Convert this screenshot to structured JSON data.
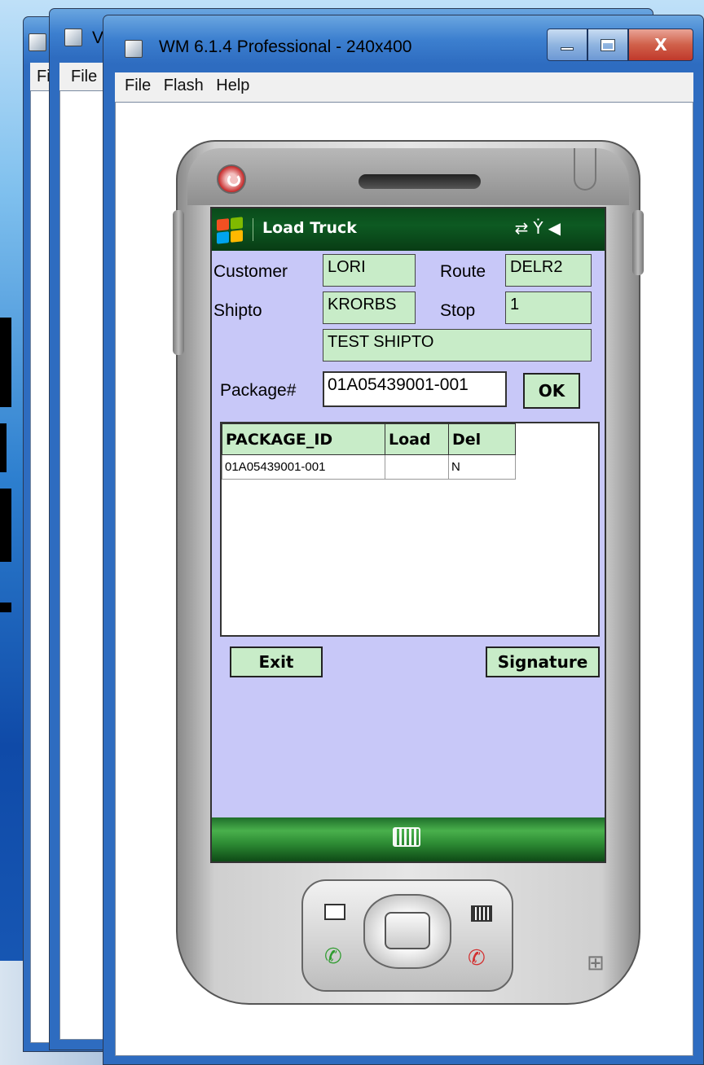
{
  "windows": {
    "back_menu_file": "Fil",
    "middle_title": "V",
    "middle_menu_file": "File"
  },
  "emulator": {
    "title": "WM 6.1.4 Professional - 240x400",
    "menu": [
      "File",
      "Flash",
      "Help"
    ],
    "caption_buttons": [
      "minimize",
      "maximize",
      "close"
    ],
    "close_glyph": "X"
  },
  "app": {
    "title": "Load Truck",
    "status_icons": [
      "connectivity-icon",
      "no-signal-icon",
      "volume-muted-icon"
    ],
    "customer_label": "Customer",
    "customer_value": "LORI",
    "route_label": "Route",
    "route_value": "DELR2",
    "shipto_label": "Shipto",
    "shipto_value": "KRORBS",
    "stop_label": "Stop",
    "stop_value": "1",
    "shipto_name": "TEST SHIPTO",
    "package_label": "Package#",
    "package_value": "01A05439001-001",
    "ok_label": "OK",
    "exit_label": "Exit",
    "signature_label": "Signature",
    "grid": {
      "columns": [
        "PACKAGE_ID",
        "Load",
        "Del"
      ],
      "rows": [
        [
          "01A05439001-001",
          "",
          "N"
        ]
      ]
    }
  },
  "colors": {
    "screen_bg": "#c8c8f8",
    "field_bg": "#c8ecc8",
    "titlebar_green": "#0d5a22"
  }
}
